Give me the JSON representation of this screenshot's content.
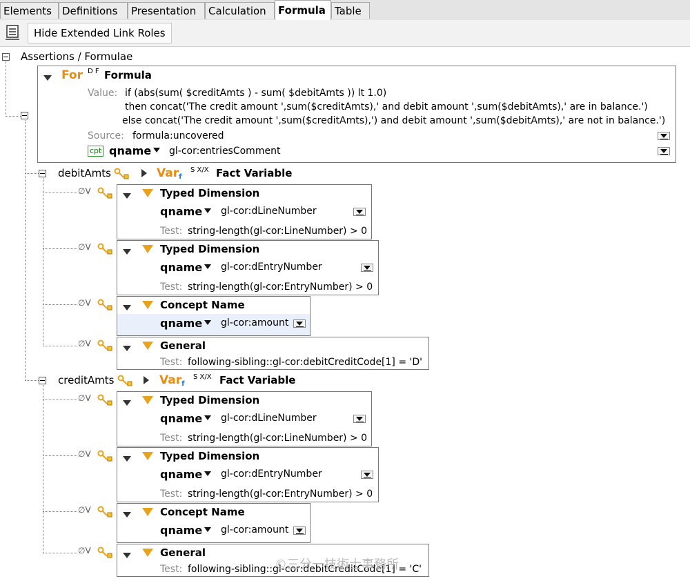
{
  "tabs": [
    {
      "label": "Elements",
      "active": false
    },
    {
      "label": "Definitions",
      "active": false
    },
    {
      "label": "Presentation",
      "active": false
    },
    {
      "label": "Calculation",
      "active": false
    },
    {
      "label": "Formula",
      "active": true
    },
    {
      "label": "Table",
      "active": false
    }
  ],
  "toolbar": {
    "toggle_label": "Hide Extended Link Roles"
  },
  "tree": {
    "root_label": "Assertions / Formulae",
    "formula": {
      "prefix": "For",
      "sup": "D F",
      "title": "Formula",
      "value_label": "Value:",
      "value_lines": [
        "if (abs(sum( $creditAmts ) - sum( $debitAmts )) lt 1.0)",
        "then concat('The credit amount ',sum($creditAmts),' and debit amount ',sum($debitAmts),' are in balance.')",
        "else concat('The credit amount ',sum($creditAmts),') and debit amount ',sum($debitAmts),' are not in balance.')"
      ],
      "source_label": "Source:",
      "source_value": "formula:uncovered",
      "cpt_badge": "cpt",
      "qname_label": "qname",
      "qname_value": "gl-cor:entriesComment"
    },
    "variables": [
      {
        "name": "debitAmts",
        "var_prefix": "Var",
        "var_sub": "f",
        "sup": "S X/X",
        "title": "Fact Variable",
        "filters": [
          {
            "flags": "∅V",
            "title": "Typed Dimension",
            "qname_label": "qname",
            "qname_value": "gl-cor:dLineNumber",
            "test_label": "Test:",
            "test_value": "string-length(gl-cor:LineNumber) > 0"
          },
          {
            "flags": "∅V",
            "title": "Typed Dimension",
            "qname_label": "qname",
            "qname_value": "gl-cor:dEntryNumber",
            "test_label": "Test:",
            "test_value": "string-length(gl-cor:EntryNumber) > 0"
          },
          {
            "flags": "∅V",
            "title": "Concept Name",
            "qname_label": "qname",
            "qname_value": "gl-cor:amount"
          },
          {
            "flags": "∅V",
            "title": "General",
            "test_label": "Test:",
            "test_value": "following-sibling::gl-cor:debitCreditCode[1] = 'D'"
          }
        ]
      },
      {
        "name": "creditAmts",
        "var_prefix": "Var",
        "var_sub": "f",
        "sup": "S X/X",
        "title": "Fact Variable",
        "filters": [
          {
            "flags": "∅V",
            "title": "Typed Dimension",
            "qname_label": "qname",
            "qname_value": "gl-cor:dLineNumber",
            "test_label": "Test:",
            "test_value": "string-length(gl-cor:LineNumber) > 0"
          },
          {
            "flags": "∅V",
            "title": "Typed Dimension",
            "qname_label": "qname",
            "qname_value": "gl-cor:dEntryNumber",
            "test_label": "Test:",
            "test_value": "string-length(gl-cor:EntryNumber) > 0"
          },
          {
            "flags": "∅V",
            "title": "Concept Name",
            "qname_label": "qname",
            "qname_value": "gl-cor:amount"
          },
          {
            "flags": "∅V",
            "title": "General",
            "test_label": "Test:",
            "test_value": "following-sibling::gl-cor:debitCreditCode[1] = 'C'"
          }
        ]
      }
    ]
  },
  "watermark": "©三分一技術士事務所",
  "colors": {
    "accent_orange": "#e88c12",
    "funnel": "#e8a21c",
    "cpt_green": "#1b7a1b",
    "selected_row": "#eaf0fb"
  }
}
